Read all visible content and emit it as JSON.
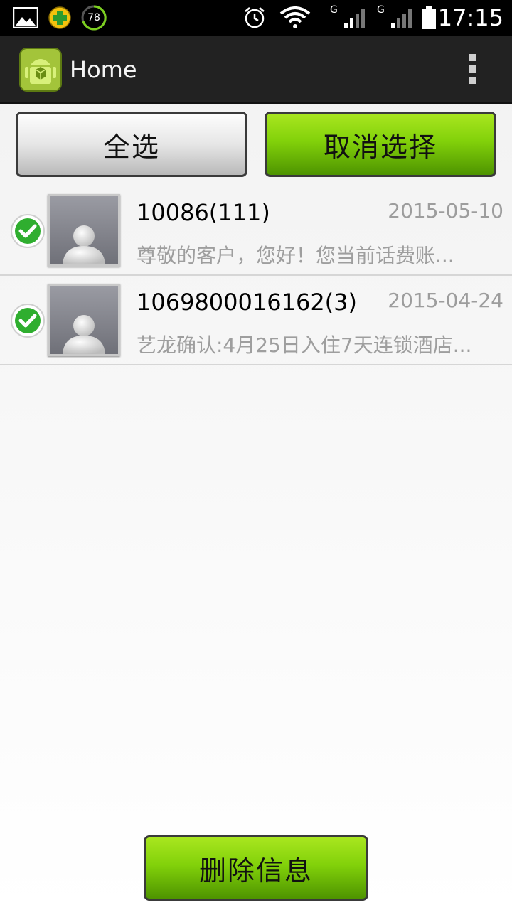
{
  "status_bar": {
    "time": "17:15",
    "battery_circle_value": "78",
    "network_label_1": "G",
    "network_label_2": "G",
    "icons": [
      "gallery-icon",
      "app-plus-icon",
      "circle-78-icon",
      "alarm-icon",
      "wifi-icon",
      "signal-1-icon",
      "signal-2-icon",
      "battery-icon"
    ]
  },
  "action_bar": {
    "title": "Home",
    "icons": [
      "android-app-icon",
      "overflow-menu-icon"
    ]
  },
  "buttons": {
    "select_all": "全选",
    "deselect": "取消选择",
    "delete": "删除信息"
  },
  "messages": [
    {
      "sender": "10086(111)",
      "date": "2015-05-10",
      "preview": "尊敬的客户，您好！您当前话费账...",
      "checked": true
    },
    {
      "sender": "1069800016162(3)",
      "date": "2015-04-24",
      "preview": "艺龙确认:4月25日入住7天连锁酒店...",
      "checked": true
    }
  ],
  "colors": {
    "accent_green": "#82d10a",
    "check_green": "#2fae2f",
    "action_bar": "#222222"
  }
}
